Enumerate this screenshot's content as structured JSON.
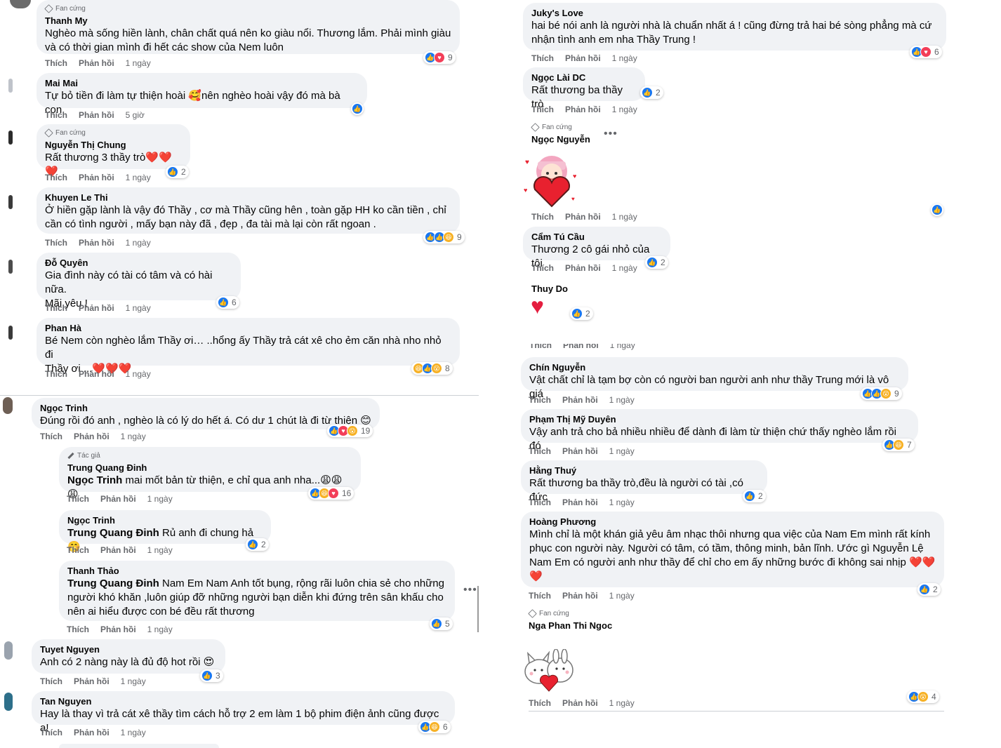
{
  "actions": {
    "like": "Thích",
    "reply": "Phản hồi"
  },
  "badges": {
    "fan": "Fan cứng",
    "author": "Tác giả"
  },
  "left": [
    {
      "name": "Thanh My",
      "badge": "Fan cứng",
      "text": "Nghèo mà sống hiền lành, chân chất quá nên ko giàu nổi. Thương lắm. Phải mình giàu\nvà có thời gian mình đi hết các show của Nem luôn",
      "time": "1 ngày",
      "count": "9"
    },
    {
      "name": "Mai Mai",
      "text": "Tự bỏ tiền đi làm tự thiện hoài 🥰nên nghèo hoài vậy đó mà bà con",
      "time": "5 giờ",
      "count": ""
    },
    {
      "name": "Nguyễn Thị Chung",
      "badge": "Fan cứng",
      "text": "Rất thương 3 thầy trò❤️❤️❤️",
      "time": "1 ngày",
      "count": "2"
    },
    {
      "name": "Khuyen Le Thi",
      "text": "Ở hiền gặp lành là vậy đó Thầy , cơ mà Thầy cũng hên , toàn gặp HH ko cần tiền , chỉ\ncần có tình người , mấy bạn này đã , đẹp , đa tài mà lại còn rất ngoan .",
      "time": "1 ngày",
      "count": "9"
    },
    {
      "name": "Đỗ Quyên",
      "text": "Gia đình này có tài có tâm và có hài nữa.\nMãi yêu !",
      "time": "1 ngày",
      "count": "6"
    },
    {
      "name": "Phan Hà",
      "text": "Bé Nem còn nghèo lắm Thầy ơi… ..hổng ấy Thầy trả cát xê cho ẻm căn nhà nho nhỏ đi\nThầy ơi ...❤️❤️❤️",
      "time": "1 ngày",
      "count": "8"
    },
    {
      "name": "Ngọc Trinh",
      "text": "Đúng rồi đó anh , nghèo là có lý do hết á. Có dư 1 chút là đi từ thiện 😊",
      "time": "1 ngày",
      "count": "19"
    },
    {
      "name": "Trung Quang Đinh",
      "badge": "Tác giả",
      "mention": "Ngọc Trinh",
      "text": " mai mốt bản từ thiện, e chỉ qua anh nha...😩😩😩",
      "time": "1 ngày",
      "count": "16"
    },
    {
      "name": "Ngọc Trinh",
      "mention": "Trung Quang Đinh",
      "text": " Rủ anh đi chung hả 🤭",
      "time": "1 ngày",
      "count": "2"
    },
    {
      "name": "Thanh Thảo",
      "mention": "Trung Quang Đinh",
      "text": " Nam Em Nam Anh tốt bụng, rộng rãi luôn chia sẻ cho những\nngười khó khăn ,luôn giúp đỡ những người bạn diễn khi đứng trên sân khấu cho\nnên ai hiểu được con bé đều rất thương",
      "time": "1 ngày",
      "count": "5"
    },
    {
      "name": "Tuyet Nguyen",
      "text": "Anh có 2 nàng này là đủ độ hot rồi 😍",
      "time": "1 ngày",
      "count": "3"
    },
    {
      "name": "Tan Nguyen",
      "text": "Hay là thay vì trả cát xê thầy tìm cách hỗ trợ 2 em làm 1 bộ phim điện ảnh cũng được ạ!",
      "time": "1 ngày",
      "count": "6"
    }
  ],
  "right": [
    {
      "name": "Juky's Love",
      "text": "hai bé nói anh là người nhà là chuẩn nhất á ! cũng đừng trả hai bé sòng phẳng mà cứ\nnhận tình anh em nha Thầy Trung !",
      "time": "1 ngày",
      "count": "6"
    },
    {
      "name": "Ngọc Lài DC",
      "text": "Rất thương ba thầy trò",
      "time": "1 ngày",
      "count": "2"
    },
    {
      "name": "Ngọc Nguyễn",
      "badge": "Fan cứng",
      "text": "",
      "time": "1 ngày",
      "count": ""
    },
    {
      "name": "Cẩm Tú Cầu",
      "text": "Thương 2 cô gái nhỏ của tôi",
      "time": "1 ngày",
      "count": "2"
    },
    {
      "name": "Thuy Do",
      "text": "",
      "time": "1 ngày",
      "count": "2"
    },
    {
      "name": "Chín Nguyễn",
      "text": "Vật chất chỉ là tạm bợ còn có người ban người anh như thầy Trung mới là vô giá",
      "time": "1 ngày",
      "count": "9"
    },
    {
      "name": "Phạm Thị Mỹ Duyên",
      "text": "Vậy anh trả cho bả nhiều nhiều để dành đi làm từ thiện chứ thấy nghèo lắm rồi đó",
      "time": "1 ngày",
      "count": "7"
    },
    {
      "name": "Hằng Thuý",
      "text": "Rất thương ba thầy trò,đều là người có tài ,có đức",
      "time": "1 ngày",
      "count": "2"
    },
    {
      "name": "Hoàng Phương",
      "text": "Mình chỉ là một khán giả yêu âm nhạc thôi nhưng qua việc của Nam Em mình rất kính\nphục con người này. Người có tâm, có tầm, thông minh, bản lĩnh. Ước gì Nguyễn Lệ\nNam Em có người anh như thầy để chỉ cho em ấy những bước đi không sai nhịp ❤️❤️\n❤️",
      "time": "1 ngày",
      "count": "2"
    },
    {
      "name": "Nga Phan Thi Ngoc",
      "badge": "Fan cứng",
      "text": "",
      "time": "1 ngày",
      "count": "4"
    }
  ],
  "colors": {
    "bubble": "#f0f2f5",
    "like": "#1877f2",
    "love": "#f33e58",
    "haha": "#f7b125",
    "meta": "#65676b"
  }
}
